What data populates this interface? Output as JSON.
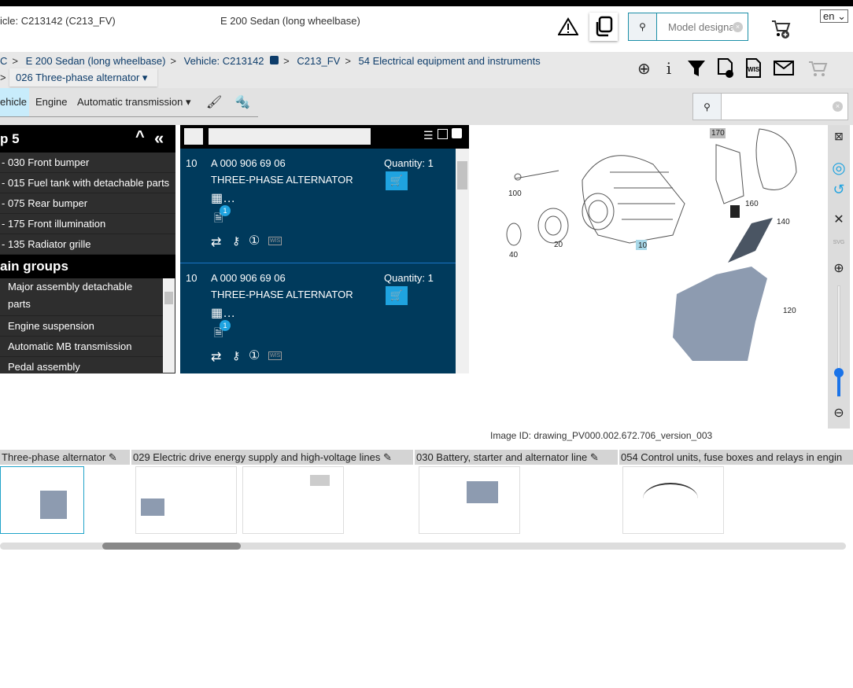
{
  "header": {
    "vehicle": "icle: C213142 (C213_FV)",
    "model": "E 200 Sedan (long wheelbase)",
    "search_placeholder": "Model designa",
    "language": "en"
  },
  "breadcrumb": {
    "items": [
      "C",
      "E 200 Sedan (long wheelbase)",
      "Vehicle: C213142",
      "C213_FV",
      "54 Electrical equipment and instruments"
    ],
    "separator": ">",
    "current_group": "026 Three-phase alternator"
  },
  "tabs": [
    {
      "label": "ehicle",
      "active": true
    },
    {
      "label": "Engine"
    },
    {
      "label": "Automatic transmission"
    }
  ],
  "tools": {
    "search_value": ""
  },
  "left_panel": {
    "title": "p 5",
    "sub_items": [
      "- 030 Front bumper",
      "- 015 Fuel tank with detachable parts",
      "- 075 Rear bumper",
      "- 175 Front illumination",
      "- 135 Radiator grille"
    ],
    "main_groups_title": "ain groups",
    "main_groups": [
      "Major assembly detachable parts",
      "Engine suspension",
      "Automatic MB transmission",
      "Pedal assembly"
    ]
  },
  "parts": [
    {
      "pos": "10",
      "number": "A 000 906 69 06",
      "name": "THREE-PHASE ALTERNATOR",
      "quantity": "Quantity: 1",
      "badge": "1",
      "wis": "WIS"
    },
    {
      "pos": "10",
      "number": "A 000 906 69 06",
      "name": "THREE-PHASE ALTERNATOR",
      "quantity": "Quantity: 1",
      "badge": "1",
      "wis": "WIS"
    }
  ],
  "drawing": {
    "callouts": [
      "170",
      "100",
      "160",
      "140",
      "40",
      "20",
      "10",
      "120"
    ],
    "image_id": "Image ID: drawing_PV000.002.672.706_version_003",
    "svg_label": "SVG",
    "zoom_level_percent": 15
  },
  "thumbnails": [
    {
      "label": "Three-phase alternator"
    },
    {
      "label": "029 Electric drive energy supply and high-voltage lines"
    },
    {
      "label": "030 Battery, starter and alternator line"
    },
    {
      "label": "054 Control units, fuse boxes and relays in engin"
    }
  ],
  "colors": {
    "accent": "#1fa3e0",
    "parts_bg": "#003a5c",
    "link": "#0d3c6a"
  }
}
